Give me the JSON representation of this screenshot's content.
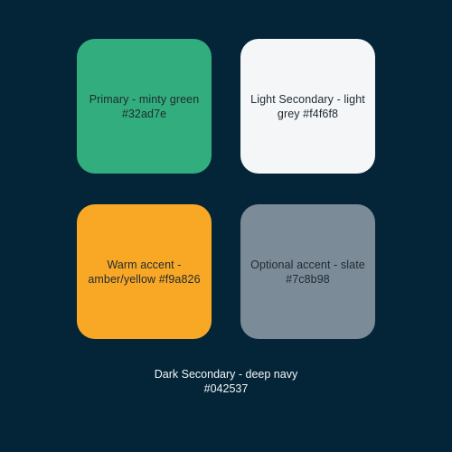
{
  "colors": {
    "background": "#042537",
    "primary": "#32ad7e",
    "light_secondary": "#f4f6f8",
    "warm_accent": "#f9a826",
    "optional_accent": "#7c8b98",
    "label_text": "#1f2a30",
    "footer_text": "#f4f6f8"
  },
  "swatches": [
    {
      "label": "Primary - minty green #32ad7e"
    },
    {
      "label": "Light Secondary - light grey #f4f6f8"
    },
    {
      "label": "Warm accent - amber/yellow #f9a826"
    },
    {
      "label": "Optional accent - slate #7c8b98"
    }
  ],
  "footer": {
    "label": "Dark Secondary - deep navy #042537"
  }
}
